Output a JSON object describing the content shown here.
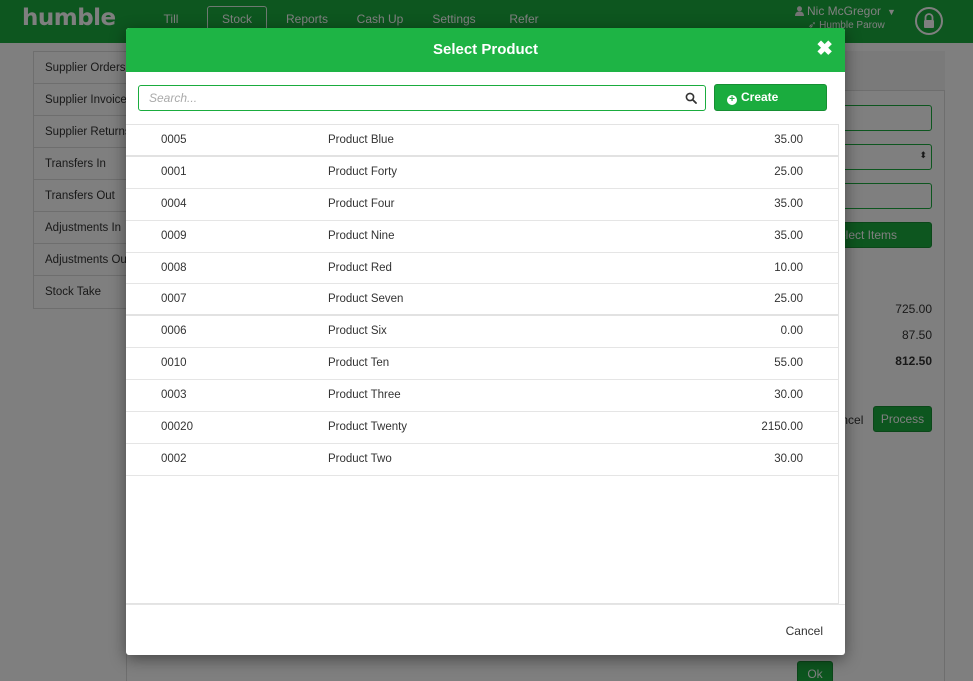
{
  "app": {
    "logo": "humble",
    "nav_tabs": [
      {
        "label": "Till"
      },
      {
        "label": "Stock"
      },
      {
        "label": "Reports"
      },
      {
        "label": "Cash Up"
      },
      {
        "label": "Settings"
      },
      {
        "label": "Refer"
      }
    ],
    "active_tab": "Stock",
    "user_name": "Nic McGregor",
    "location": "Humble Parow"
  },
  "sidebar": {
    "items": [
      {
        "label": "Supplier Orders"
      },
      {
        "label": "Supplier Invoices"
      },
      {
        "label": "Supplier Returns"
      },
      {
        "label": "Transfers In"
      },
      {
        "label": "Transfers Out"
      },
      {
        "label": "Adjustments In"
      },
      {
        "label": "Adjustments Out"
      },
      {
        "label": "Stock Take"
      }
    ]
  },
  "background": {
    "select_items_label": "Select Items",
    "subtotal": "725.00",
    "tax": "87.50",
    "total": "812.50",
    "cancel_label": "Cancel",
    "process_label": "Process",
    "ok_label": "Ok"
  },
  "modal": {
    "title": "Select Product",
    "search_placeholder": "Search...",
    "search_value": "",
    "create_button_label": "Create Product",
    "cancel_label": "Cancel",
    "products": [
      {
        "code": "0005",
        "name": "Product Blue",
        "price": "35.00"
      },
      {
        "code": "0001",
        "name": "Product Forty",
        "price": "25.00"
      },
      {
        "code": "0004",
        "name": "Product Four",
        "price": "35.00"
      },
      {
        "code": "0009",
        "name": "Product Nine",
        "price": "35.00"
      },
      {
        "code": "0008",
        "name": "Product Red",
        "price": "10.00"
      },
      {
        "code": "0007",
        "name": "Product Seven",
        "price": "25.00"
      },
      {
        "code": "0006",
        "name": "Product Six",
        "price": "0.00"
      },
      {
        "code": "0010",
        "name": "Product Ten",
        "price": "55.00"
      },
      {
        "code": "0003",
        "name": "Product Three",
        "price": "30.00"
      },
      {
        "code": "00020",
        "name": "Product Twenty",
        "price": "2150.00"
      },
      {
        "code": "0002",
        "name": "Product Two",
        "price": "30.00"
      }
    ]
  },
  "colors": {
    "brand_green": "#1aac3e",
    "modal_header_green": "#1eb445"
  },
  "icons": {
    "close": "close-icon",
    "search": "search-icon",
    "create": "plus-circle-icon",
    "user": "user-icon",
    "lock": "lock-icon",
    "caret": "caret-down-icon"
  }
}
